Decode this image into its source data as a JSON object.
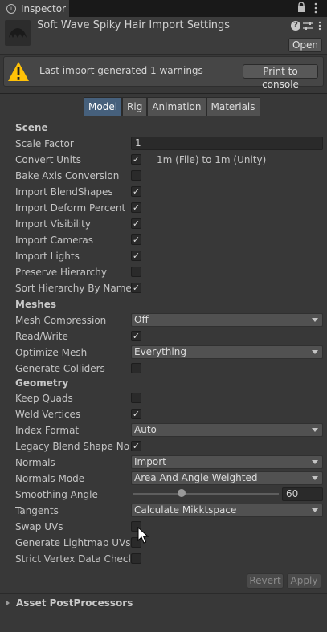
{
  "tab": {
    "label": "Inspector",
    "icon": "info-icon"
  },
  "header": {
    "title": "Soft Wave Spiky Hair Import Settings",
    "open_label": "Open"
  },
  "warning": {
    "text": "Last import generated 1 warnings",
    "button": "Print to console"
  },
  "tabs": [
    "Model",
    "Rig",
    "Animation",
    "Materials"
  ],
  "active_tab": "Model",
  "sections": {
    "scene": "Scene",
    "meshes": "Meshes",
    "geometry": "Geometry"
  },
  "scene": {
    "scale_factor_label": "Scale Factor",
    "scale_factor_value": "1",
    "convert_units_label": "Convert Units",
    "convert_units_note": "1m (File) to 1m (Unity)",
    "bake_axis_label": "Bake Axis Conversion",
    "blendshapes_label": "Import BlendShapes",
    "deform_percent_label": "Import Deform Percent",
    "visibility_label": "Import Visibility",
    "cameras_label": "Import Cameras",
    "lights_label": "Import Lights",
    "preserve_hierarchy_label": "Preserve Hierarchy",
    "sort_hierarchy_label": "Sort Hierarchy By Name"
  },
  "meshes": {
    "compression_label": "Mesh Compression",
    "compression_value": "Off",
    "read_write_label": "Read/Write",
    "optimize_label": "Optimize Mesh",
    "optimize_value": "Everything",
    "colliders_label": "Generate Colliders"
  },
  "geometry": {
    "keep_quads_label": "Keep Quads",
    "weld_label": "Weld Vertices",
    "index_format_label": "Index Format",
    "index_format_value": "Auto",
    "legacy_blend_label": "Legacy Blend Shape Normals",
    "normals_label": "Normals",
    "normals_value": "Import",
    "normals_mode_label": "Normals Mode",
    "normals_mode_value": "Area And Angle Weighted",
    "smoothing_label": "Smoothing Angle",
    "smoothing_value": "60",
    "tangents_label": "Tangents",
    "tangents_value": "Calculate Mikktspace",
    "swap_uvs_label": "Swap UVs",
    "lightmap_uvs_label": "Generate Lightmap UVs",
    "strict_vertex_label": "Strict Vertex Data Checks"
  },
  "checkmark": "✓",
  "footer": {
    "revert": "Revert",
    "apply": "Apply"
  },
  "postprocessors": {
    "label": "Asset PostProcessors"
  }
}
